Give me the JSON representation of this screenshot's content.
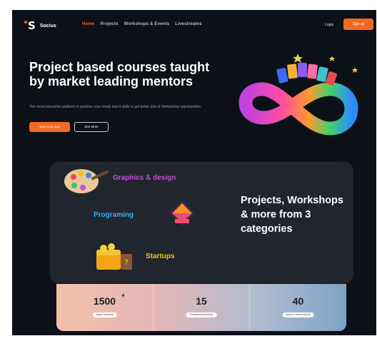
{
  "nav": {
    "logo_text": "Socius",
    "links": [
      "Home",
      "Projects",
      "Workshops & Events",
      "Livestreams"
    ],
    "active_index": 0,
    "login_label": "Login",
    "signup_label": "Sign up"
  },
  "hero": {
    "title": "Project based courses taught by market leading mentors",
    "subtitle": "The most interactive platform to practice your newly learnt skills to get better jobs & Networking opportunities",
    "primary_button": "Start your Day",
    "secondary_button": "See More"
  },
  "categories": {
    "items": [
      {
        "label": "Graphics & design",
        "color": "#c44fd9",
        "icon": "palette-icon"
      },
      {
        "label": "Programing",
        "color": "#2fb6f2",
        "icon": "code-gem-icon"
      },
      {
        "label": "Startups",
        "color": "#f3c415",
        "icon": "treasure-chest-icon"
      }
    ],
    "heading": "Projects, Workshops & more from 3 categories"
  },
  "stats": [
    {
      "value": "1500",
      "suffix": "+",
      "label": "Active Students"
    },
    {
      "value": "15",
      "suffix": "",
      "label": "Professional Mentors"
    },
    {
      "value": "40",
      "suffix": "",
      "label": "Hand to class projects"
    }
  ],
  "colors": {
    "background": "#0c1117",
    "accent": "#f26a21",
    "card": "#20252e"
  }
}
